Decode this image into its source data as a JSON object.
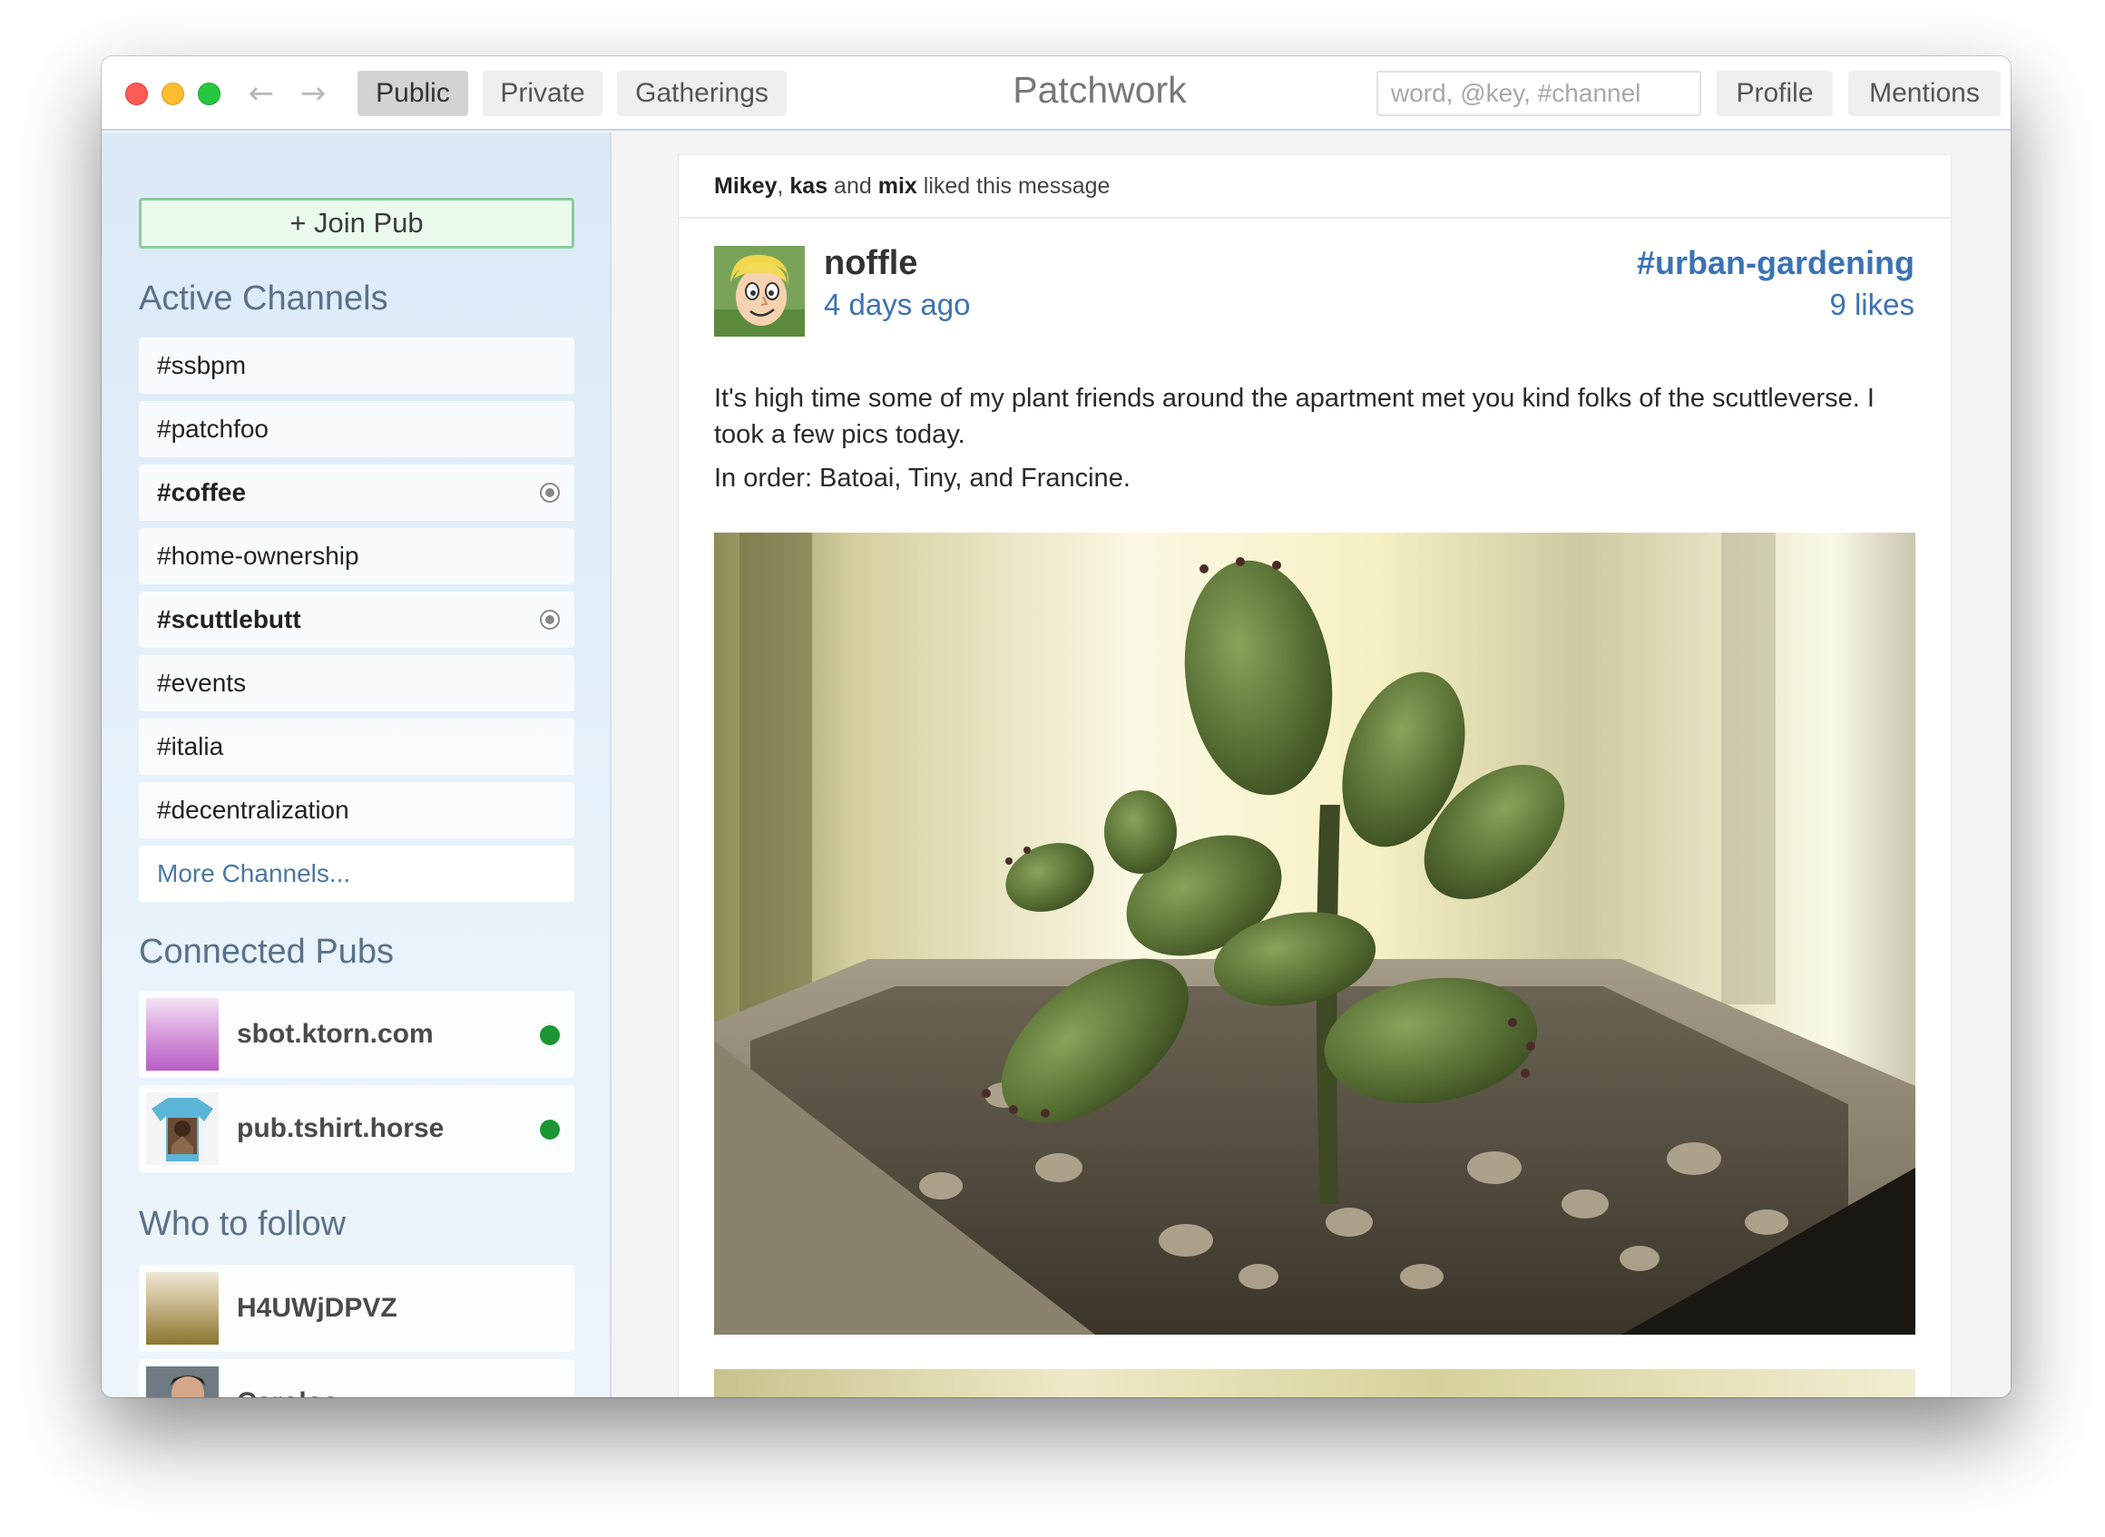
{
  "window": {
    "title": "Patchwork"
  },
  "nav": {
    "tabs": [
      {
        "label": "Public",
        "active": true
      },
      {
        "label": "Private",
        "active": false
      },
      {
        "label": "Gatherings",
        "active": false
      }
    ],
    "search_placeholder": "word, @key, #channel",
    "profile_label": "Profile",
    "mentions_label": "Mentions",
    "back_icon": "←",
    "forward_icon": "→"
  },
  "sidebar": {
    "join_pub_label": "+ Join Pub",
    "active_channels_title": "Active Channels",
    "channels": [
      {
        "label": "#ssbpm",
        "subscribed": false
      },
      {
        "label": "#patchfoo",
        "subscribed": false
      },
      {
        "label": "#coffee",
        "subscribed": true
      },
      {
        "label": "#home-ownership",
        "subscribed": false
      },
      {
        "label": "#scuttlebutt",
        "subscribed": true
      },
      {
        "label": "#events",
        "subscribed": false
      },
      {
        "label": "#italia",
        "subscribed": false
      },
      {
        "label": "#decentralization",
        "subscribed": false
      }
    ],
    "more_channels_label": "More Channels...",
    "connected_pubs_title": "Connected Pubs",
    "pubs": [
      {
        "name": "sbot.ktorn.com",
        "status_color": "#1b9633"
      },
      {
        "name": "pub.tshirt.horse",
        "status_color": "#1b9633"
      }
    ],
    "who_to_follow_title": "Who to follow",
    "follow_suggestions": [
      {
        "name": "H4UWjDPVZ"
      },
      {
        "name": "Carolos"
      }
    ]
  },
  "feed": {
    "likes_bar": {
      "names": [
        "Mikey",
        "kas",
        "mix"
      ],
      "sep1": ", ",
      "sep2": " and ",
      "suffix": " liked this message"
    },
    "post": {
      "author": "noffle",
      "time": "4 days ago",
      "channel": "#urban-gardening",
      "likes": "9 likes",
      "paragraphs": [
        "It's high time some of my plant friends around the apartment met you kind folks of the scuttleverse. I took a few pics today.",
        "In order: Batoai, Tiny, and Francine."
      ]
    }
  },
  "colors": {
    "accent_link": "#3b73b4",
    "join_button_bg": "#eafbee",
    "join_button_border": "#8ccb9c",
    "online": "#1b9633",
    "section_title": "#5b7189"
  }
}
